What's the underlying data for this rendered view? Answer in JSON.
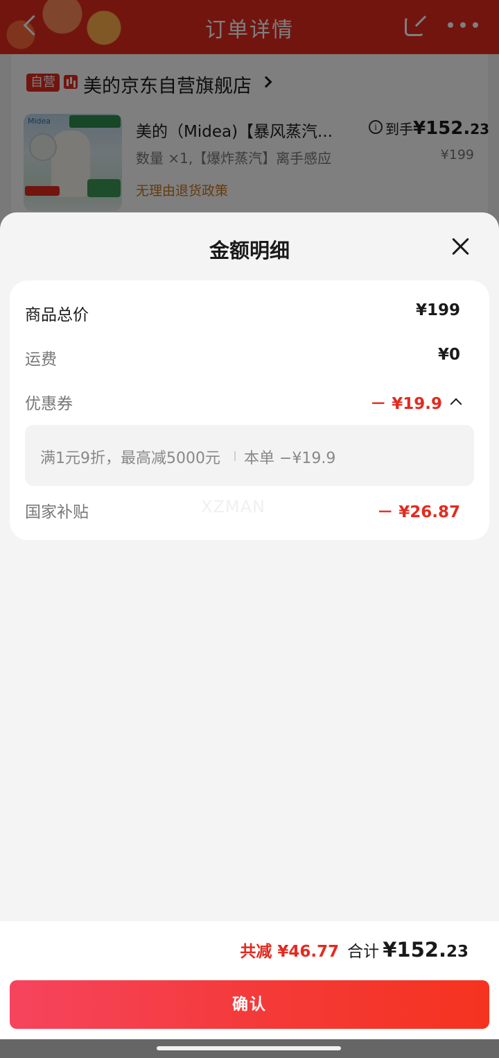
{
  "background_page": {
    "title": "订单详情",
    "store": {
      "badge": "自营",
      "name": "美的京东自营旗舰店"
    },
    "product": {
      "title": "美的（Midea)【暴风蒸汽...",
      "final_price_prefix": "到手",
      "final_price_main": "¥152.",
      "final_price_decimal": "23",
      "spec": "数量 ×1,【爆炸蒸汽】离手感应",
      "original_price": "¥199",
      "return_policy": "无理由退货政策"
    }
  },
  "sheet": {
    "title": "金额明细",
    "rows": {
      "goods_total": {
        "label": "商品总价",
        "amount": "¥199"
      },
      "shipping": {
        "label": "运费",
        "amount": "¥0"
      },
      "coupon": {
        "label": "优惠券",
        "amount": "－ ¥19.9",
        "rule": "满1元9折，最高减5000元",
        "this_order": "本单 −¥19.9"
      },
      "subsidy": {
        "label": "国家补贴",
        "amount": "－ ¥26.87"
      }
    },
    "watermark": "XZMAN"
  },
  "footer": {
    "saved": "共减 ¥46.77",
    "total_label": "合计",
    "total_main": "¥152.",
    "total_decimal": "23",
    "confirm_label": "确认"
  },
  "colors": {
    "accent_red": "#e42a1f",
    "button_gradient_start": "#f6445e",
    "button_gradient_end": "#f5331f",
    "policy_orange": "#c7771a"
  },
  "icons": [
    "back-icon",
    "share-icon",
    "more-icon",
    "store-icon",
    "info-icon",
    "close-icon",
    "chevron-right-icon",
    "chevron-up-icon"
  ]
}
